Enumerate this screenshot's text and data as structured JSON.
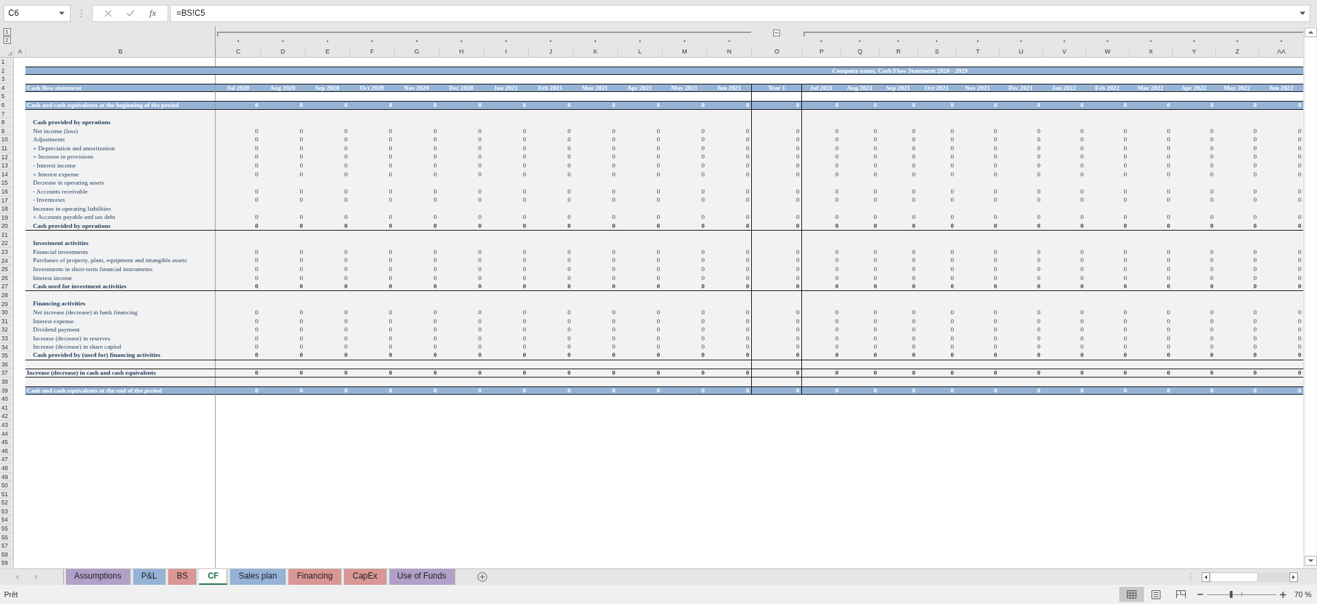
{
  "formula_bar": {
    "name_box": "C6",
    "function_button": "fx",
    "formula": "=BS!C5"
  },
  "outline_levels": [
    "1",
    "2"
  ],
  "columns": [
    "A",
    "B",
    "C",
    "D",
    "E",
    "F",
    "G",
    "H",
    "I",
    "J",
    "K",
    "L",
    "M",
    "N",
    "O",
    "P",
    "Q",
    "R",
    "S",
    "T",
    "U",
    "V",
    "W",
    "X",
    "Y",
    "Z",
    "AA"
  ],
  "rows": [
    {
      "number": "1",
      "kind": "spacer",
      "shaded": false
    },
    {
      "number": "2",
      "kind": "title",
      "shaded": false,
      "title": "Company name, Cash Flow Statement 2020 - 2029"
    },
    {
      "number": "3",
      "kind": "spacer",
      "shaded": false
    },
    {
      "number": "4",
      "kind": "header",
      "shaded": false,
      "label": "Cash flow statement",
      "values": [
        "Jul 2020",
        "Aug 2020",
        "Sep 2020",
        "Oct 2020",
        "Nov 2020",
        "Dec 2020",
        "Jan 2021",
        "Feb 2021",
        "Mar 2021",
        "Apr 2021",
        "May 2021",
        "Jun 2021",
        "Year 1",
        "Jul 2021",
        "Aug 2021",
        "Sep 2021",
        "Oct 2021",
        "Nov 2021",
        "Dec 2021",
        "Jan 2022",
        "Feb 2022",
        "Mar 2022",
        "Apr 2022",
        "May 2022",
        "Jun 2022"
      ]
    },
    {
      "number": "5",
      "kind": "gap",
      "shaded": false
    },
    {
      "number": "6",
      "kind": "band",
      "shaded": false,
      "label": "Cash and cash equivalents at the beginning of the period",
      "values": [
        "0",
        "0",
        "0",
        "0",
        "0",
        "0",
        "0",
        "0",
        "0",
        "0",
        "0",
        "0",
        "0",
        "0",
        "0",
        "0",
        "0",
        "0",
        "0",
        "0",
        "0",
        "0",
        "0",
        "0",
        "0"
      ]
    },
    {
      "number": "7",
      "kind": "gap",
      "shaded": true
    },
    {
      "number": "8",
      "kind": "section",
      "shaded": true,
      "label": "Cash provided by operations"
    },
    {
      "number": "9",
      "kind": "item",
      "shaded": true,
      "label": "Net income (loss)",
      "values": [
        "0",
        "0",
        "0",
        "0",
        "0",
        "0",
        "0",
        "0",
        "0",
        "0",
        "0",
        "0",
        "0",
        "0",
        "0",
        "0",
        "0",
        "0",
        "0",
        "0",
        "0",
        "0",
        "0",
        "0",
        "0"
      ]
    },
    {
      "number": "10",
      "kind": "item",
      "shaded": true,
      "label": "Adjustments",
      "values": [
        "0",
        "0",
        "0",
        "0",
        "0",
        "0",
        "0",
        "0",
        "0",
        "0",
        "0",
        "0",
        "0",
        "0",
        "0",
        "0",
        "0",
        "0",
        "0",
        "0",
        "0",
        "0",
        "0",
        "0",
        "0"
      ]
    },
    {
      "number": "11",
      "kind": "item",
      "shaded": true,
      "label": "+ Depreciation and amortization",
      "values": [
        "0",
        "0",
        "0",
        "0",
        "0",
        "0",
        "0",
        "0",
        "0",
        "0",
        "0",
        "0",
        "0",
        "0",
        "0",
        "0",
        "0",
        "0",
        "0",
        "0",
        "0",
        "0",
        "0",
        "0",
        "0"
      ]
    },
    {
      "number": "12",
      "kind": "item",
      "shaded": true,
      "label": "+ Increase in provisions",
      "values": [
        "0",
        "0",
        "0",
        "0",
        "0",
        "0",
        "0",
        "0",
        "0",
        "0",
        "0",
        "0",
        "0",
        "0",
        "0",
        "0",
        "0",
        "0",
        "0",
        "0",
        "0",
        "0",
        "0",
        "0",
        "0"
      ]
    },
    {
      "number": "13",
      "kind": "item",
      "shaded": true,
      "label": "- Interest income",
      "values": [
        "0",
        "0",
        "0",
        "0",
        "0",
        "0",
        "0",
        "0",
        "0",
        "0",
        "0",
        "0",
        "0",
        "0",
        "0",
        "0",
        "0",
        "0",
        "0",
        "0",
        "0",
        "0",
        "0",
        "0",
        "0"
      ]
    },
    {
      "number": "14",
      "kind": "item",
      "shaded": true,
      "label": "+ Interest expense",
      "values": [
        "0",
        "0",
        "0",
        "0",
        "0",
        "0",
        "0",
        "0",
        "0",
        "0",
        "0",
        "0",
        "0",
        "0",
        "0",
        "0",
        "0",
        "0",
        "0",
        "0",
        "0",
        "0",
        "0",
        "0",
        "0"
      ]
    },
    {
      "number": "15",
      "kind": "item",
      "shaded": true,
      "label": "Decrease in operating assets"
    },
    {
      "number": "16",
      "kind": "item",
      "shaded": true,
      "label": "- Accounts receivable",
      "values": [
        "0",
        "0",
        "0",
        "0",
        "0",
        "0",
        "0",
        "0",
        "0",
        "0",
        "0",
        "0",
        "0",
        "0",
        "0",
        "0",
        "0",
        "0",
        "0",
        "0",
        "0",
        "0",
        "0",
        "0",
        "0"
      ]
    },
    {
      "number": "17",
      "kind": "item",
      "shaded": true,
      "label": "- Inventories",
      "values": [
        "0",
        "0",
        "0",
        "0",
        "0",
        "0",
        "0",
        "0",
        "0",
        "0",
        "0",
        "0",
        "0",
        "0",
        "0",
        "0",
        "0",
        "0",
        "0",
        "0",
        "0",
        "0",
        "0",
        "0",
        "0"
      ]
    },
    {
      "number": "18",
      "kind": "item",
      "shaded": true,
      "label": "Increase in operating liabilities"
    },
    {
      "number": "19",
      "kind": "item",
      "shaded": true,
      "label": "+ Accounts payable and tax debt",
      "values": [
        "0",
        "0",
        "0",
        "0",
        "0",
        "0",
        "0",
        "0",
        "0",
        "0",
        "0",
        "0",
        "0",
        "0",
        "0",
        "0",
        "0",
        "0",
        "0",
        "0",
        "0",
        "0",
        "0",
        "0",
        "0"
      ]
    },
    {
      "number": "20",
      "kind": "subtotal",
      "shaded": true,
      "label": "Cash provided by operations",
      "values": [
        "0",
        "0",
        "0",
        "0",
        "0",
        "0",
        "0",
        "0",
        "0",
        "0",
        "0",
        "0",
        "0",
        "0",
        "0",
        "0",
        "0",
        "0",
        "0",
        "0",
        "0",
        "0",
        "0",
        "0",
        "0"
      ]
    },
    {
      "number": "21",
      "kind": "gap",
      "shaded": true
    },
    {
      "number": "22",
      "kind": "section",
      "shaded": true,
      "label": "Investment activities"
    },
    {
      "number": "23",
      "kind": "item",
      "shaded": true,
      "label": "Financial investments",
      "values": [
        "0",
        "0",
        "0",
        "0",
        "0",
        "0",
        "0",
        "0",
        "0",
        "0",
        "0",
        "0",
        "0",
        "0",
        "0",
        "0",
        "0",
        "0",
        "0",
        "0",
        "0",
        "0",
        "0",
        "0",
        "0"
      ]
    },
    {
      "number": "24",
      "kind": "item",
      "shaded": true,
      "label": "Purchases of property, plant, equipment and intangible assets",
      "values": [
        "0",
        "0",
        "0",
        "0",
        "0",
        "0",
        "0",
        "0",
        "0",
        "0",
        "0",
        "0",
        "0",
        "0",
        "0",
        "0",
        "0",
        "0",
        "0",
        "0",
        "0",
        "0",
        "0",
        "0",
        "0"
      ]
    },
    {
      "number": "25",
      "kind": "item",
      "shaded": true,
      "label": "Investments in short-term financial instrumetns",
      "values": [
        "0",
        "0",
        "0",
        "0",
        "0",
        "0",
        "0",
        "0",
        "0",
        "0",
        "0",
        "0",
        "0",
        "0",
        "0",
        "0",
        "0",
        "0",
        "0",
        "0",
        "0",
        "0",
        "0",
        "0",
        "0"
      ]
    },
    {
      "number": "26",
      "kind": "item",
      "shaded": true,
      "label": "Interest income",
      "values": [
        "0",
        "0",
        "0",
        "0",
        "0",
        "0",
        "0",
        "0",
        "0",
        "0",
        "0",
        "0",
        "0",
        "0",
        "0",
        "0",
        "0",
        "0",
        "0",
        "0",
        "0",
        "0",
        "0",
        "0",
        "0"
      ]
    },
    {
      "number": "27",
      "kind": "subtotal",
      "shaded": true,
      "label": "Cash used for investment activities",
      "values": [
        "0",
        "0",
        "0",
        "0",
        "0",
        "0",
        "0",
        "0",
        "0",
        "0",
        "0",
        "0",
        "0",
        "0",
        "0",
        "0",
        "0",
        "0",
        "0",
        "0",
        "0",
        "0",
        "0",
        "0",
        "0"
      ]
    },
    {
      "number": "28",
      "kind": "gap",
      "shaded": true
    },
    {
      "number": "29",
      "kind": "section",
      "shaded": true,
      "label": "Financing activities"
    },
    {
      "number": "30",
      "kind": "item",
      "shaded": true,
      "label": "Net increase (decrease) in bank financing",
      "values": [
        "0",
        "0",
        "0",
        "0",
        "0",
        "0",
        "0",
        "0",
        "0",
        "0",
        "0",
        "0",
        "0",
        "0",
        "0",
        "0",
        "0",
        "0",
        "0",
        "0",
        "0",
        "0",
        "0",
        "0",
        "0"
      ]
    },
    {
      "number": "31",
      "kind": "item",
      "shaded": true,
      "label": "Interest expense",
      "values": [
        "0",
        "0",
        "0",
        "0",
        "0",
        "0",
        "0",
        "0",
        "0",
        "0",
        "0",
        "0",
        "0",
        "0",
        "0",
        "0",
        "0",
        "0",
        "0",
        "0",
        "0",
        "0",
        "0",
        "0",
        "0"
      ]
    },
    {
      "number": "32",
      "kind": "item",
      "shaded": true,
      "label": "Dividend payment",
      "values": [
        "0",
        "0",
        "0",
        "0",
        "0",
        "0",
        "0",
        "0",
        "0",
        "0",
        "0",
        "0",
        "0",
        "0",
        "0",
        "0",
        "0",
        "0",
        "0",
        "0",
        "0",
        "0",
        "0",
        "0",
        "0"
      ]
    },
    {
      "number": "33",
      "kind": "item",
      "shaded": true,
      "label": "Increase (decrease) in reserves",
      "values": [
        "0",
        "0",
        "0",
        "0",
        "0",
        "0",
        "0",
        "0",
        "0",
        "0",
        "0",
        "0",
        "0",
        "0",
        "0",
        "0",
        "0",
        "0",
        "0",
        "0",
        "0",
        "0",
        "0",
        "0",
        "0"
      ]
    },
    {
      "number": "34",
      "kind": "item",
      "shaded": true,
      "label": "Increase (decrease) in share capital",
      "values": [
        "0",
        "0",
        "0",
        "0",
        "0",
        "0",
        "0",
        "0",
        "0",
        "0",
        "0",
        "0",
        "0",
        "0",
        "0",
        "0",
        "0",
        "0",
        "0",
        "0",
        "0",
        "0",
        "0",
        "0",
        "0"
      ]
    },
    {
      "number": "35",
      "kind": "subtotal",
      "shaded": true,
      "label": "Cash provided by (used for) financing activities",
      "values": [
        "0",
        "0",
        "0",
        "0",
        "0",
        "0",
        "0",
        "0",
        "0",
        "0",
        "0",
        "0",
        "0",
        "0",
        "0",
        "0",
        "0",
        "0",
        "0",
        "0",
        "0",
        "0",
        "0",
        "0",
        "0"
      ]
    },
    {
      "number": "36",
      "kind": "gap",
      "shaded": true
    },
    {
      "number": "37",
      "kind": "total",
      "shaded": true,
      "label": "Increase (decrease) in cash and cash equivalents",
      "values": [
        "0",
        "0",
        "0",
        "0",
        "0",
        "0",
        "0",
        "0",
        "0",
        "0",
        "0",
        "0",
        "0",
        "0",
        "0",
        "0",
        "0",
        "0",
        "0",
        "0",
        "0",
        "0",
        "0",
        "0",
        "0"
      ]
    },
    {
      "number": "38",
      "kind": "gap",
      "shaded": true
    },
    {
      "number": "39",
      "kind": "band",
      "shaded": false,
      "label": "Cash and cash equivalents at the end of the period",
      "values": [
        "0",
        "0",
        "0",
        "0",
        "0",
        "0",
        "0",
        "0",
        "0",
        "0",
        "0",
        "0",
        "0",
        "0",
        "0",
        "0",
        "0",
        "0",
        "0",
        "0",
        "0",
        "0",
        "0",
        "0",
        "0"
      ]
    },
    {
      "number": "40",
      "kind": "spacer",
      "shaded": false
    },
    {
      "number": "41",
      "kind": "spacer",
      "shaded": false
    },
    {
      "number": "42",
      "kind": "spacer",
      "shaded": false
    },
    {
      "number": "43",
      "kind": "spacer",
      "shaded": false
    },
    {
      "number": "44",
      "kind": "spacer",
      "shaded": false
    },
    {
      "number": "45",
      "kind": "spacer",
      "shaded": false
    },
    {
      "number": "46",
      "kind": "spacer",
      "shaded": false
    },
    {
      "number": "47",
      "kind": "spacer",
      "shaded": false
    },
    {
      "number": "48",
      "kind": "spacer",
      "shaded": false
    },
    {
      "number": "49",
      "kind": "spacer",
      "shaded": false
    },
    {
      "number": "50",
      "kind": "spacer",
      "shaded": false
    },
    {
      "number": "51",
      "kind": "spacer",
      "shaded": false
    },
    {
      "number": "52",
      "kind": "spacer",
      "shaded": false
    },
    {
      "number": "53",
      "kind": "spacer",
      "shaded": false
    },
    {
      "number": "54",
      "kind": "spacer",
      "shaded": false
    },
    {
      "number": "55",
      "kind": "spacer",
      "shaded": false
    },
    {
      "number": "56",
      "kind": "spacer",
      "shaded": false
    },
    {
      "number": "57",
      "kind": "spacer",
      "shaded": false
    },
    {
      "number": "58",
      "kind": "spacer",
      "shaded": false
    },
    {
      "number": "59",
      "kind": "spacer",
      "shaded": false
    }
  ],
  "sheet_tabs": [
    {
      "label": "Assumptions",
      "selected": false,
      "color": "#b1a0c7"
    },
    {
      "label": "P&L",
      "selected": false,
      "color": "#95b3d7"
    },
    {
      "label": "BS",
      "selected": false,
      "color": "#da9694"
    },
    {
      "label": "CF",
      "selected": true
    },
    {
      "label": "Sales plan",
      "selected": false,
      "color": "#95b3d7"
    },
    {
      "label": "Financing",
      "selected": false,
      "color": "#da9694"
    },
    {
      "label": "CapEx",
      "selected": false,
      "color": "#da9694"
    },
    {
      "label": "Use of Funds",
      "selected": false,
      "color": "#b1a0c7"
    }
  ],
  "status_bar": {
    "status": "Prêt",
    "views": [
      {
        "kind": "normal",
        "selected": true
      },
      {
        "kind": "page-layout",
        "selected": false
      },
      {
        "kind": "page-break",
        "selected": false
      }
    ],
    "zoom": {
      "level": 0.35,
      "reading": "70 %"
    }
  }
}
